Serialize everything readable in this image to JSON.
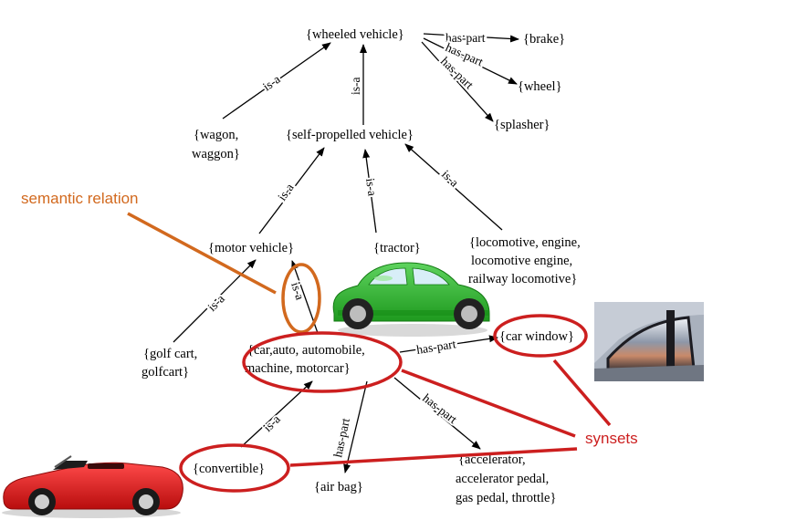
{
  "colors": {
    "arrow": "#000000",
    "semantic_relation": "#d2691e",
    "synsets": "#cc1f1f",
    "green_car": "#2db52d",
    "red_car": "#d01414"
  },
  "nodes": {
    "wheeled_vehicle": "{wheeled vehicle}",
    "brake": "{brake}",
    "wheel": "{wheel}",
    "splasher": "{splasher}",
    "wagon_l1": "{wagon,",
    "wagon_l2": "waggon}",
    "self_propelled": "{self-propelled vehicle}",
    "motor_vehicle": "{motor vehicle}",
    "tractor": "{tractor}",
    "loco_l1": "{locomotive, engine,",
    "loco_l2": "locomotive engine,",
    "loco_l3": "railway locomotive}",
    "golf_l1": "{golf cart,",
    "golf_l2": "golfcart}",
    "car_l1": "{car,auto, automobile,",
    "car_l2": "machine, motorcar}",
    "car_window": "{car window}",
    "convertible": "{convertible}",
    "air_bag": "{air bag}",
    "accel_l1": "{accelerator,",
    "accel_l2": "accelerator pedal,",
    "accel_l3": "gas pedal, throttle}"
  },
  "relations": {
    "is_a": "is-a",
    "has_part": "has-part"
  },
  "annotations": {
    "semantic_relation": "semantic relation",
    "synsets": "synsets"
  },
  "icons": [
    "green-car-icon",
    "red-convertible-icon",
    "car-window-photo"
  ]
}
